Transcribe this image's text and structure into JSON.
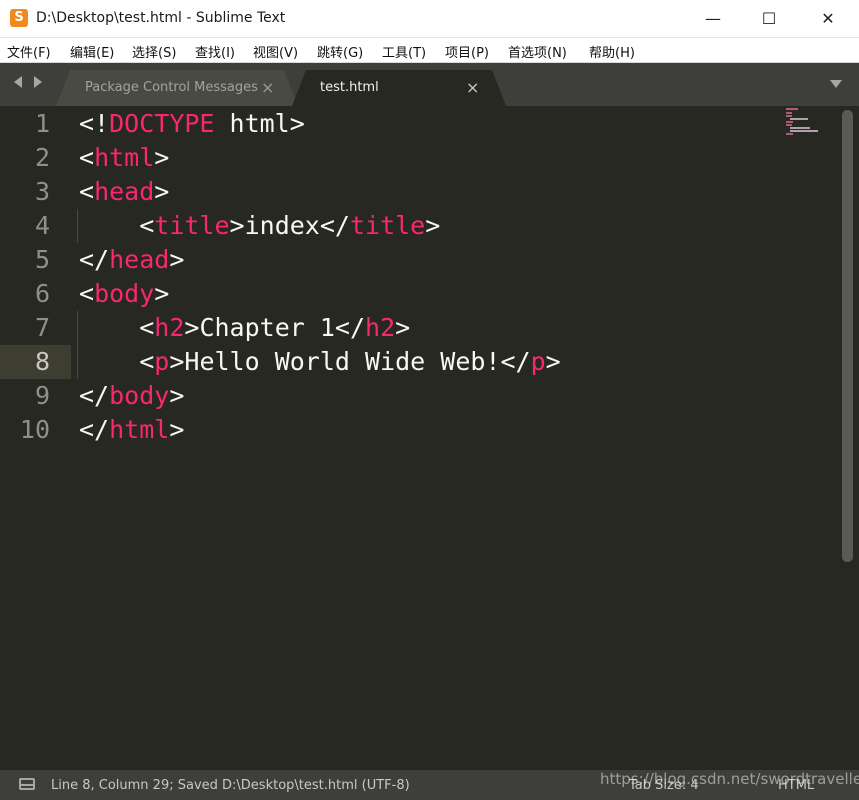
{
  "window": {
    "title": "D:\\Desktop\\test.html - Sublime Text",
    "app_icon": "S",
    "controls": {
      "minimize": "—",
      "maximize": "☐",
      "close": "✕"
    }
  },
  "menu": [
    "文件(F)",
    "编辑(E)",
    "选择(S)",
    "查找(I)",
    "视图(V)",
    "跳转(G)",
    "工具(T)",
    "项目(P)",
    "首选项(N)",
    "帮助(H)"
  ],
  "tabs": [
    {
      "label": "Package Control Messages",
      "active": false,
      "close": "×"
    },
    {
      "label": "test.html",
      "active": true,
      "close": "×"
    }
  ],
  "editor": {
    "current_line": 8,
    "lines": [
      {
        "num": "1",
        "indent": "",
        "parts": [
          [
            "p",
            "<!"
          ],
          [
            "t",
            "DOCTYPE"
          ],
          [
            "p",
            " html>"
          ]
        ]
      },
      {
        "num": "2",
        "indent": "",
        "parts": [
          [
            "p",
            "<"
          ],
          [
            "t",
            "html"
          ],
          [
            "p",
            ">"
          ]
        ]
      },
      {
        "num": "3",
        "indent": "",
        "parts": [
          [
            "p",
            "<"
          ],
          [
            "t",
            "head"
          ],
          [
            "p",
            ">"
          ]
        ]
      },
      {
        "num": "4",
        "indent": "    ",
        "parts": [
          [
            "p",
            "<"
          ],
          [
            "t",
            "title"
          ],
          [
            "p",
            ">index</"
          ],
          [
            "t",
            "title"
          ],
          [
            "p",
            ">"
          ]
        ]
      },
      {
        "num": "5",
        "indent": "",
        "parts": [
          [
            "p",
            "</"
          ],
          [
            "t",
            "head"
          ],
          [
            "p",
            ">"
          ]
        ]
      },
      {
        "num": "6",
        "indent": "",
        "parts": [
          [
            "p",
            "<"
          ],
          [
            "t",
            "body"
          ],
          [
            "p",
            ">"
          ]
        ]
      },
      {
        "num": "7",
        "indent": "    ",
        "parts": [
          [
            "p",
            "<"
          ],
          [
            "t",
            "h2"
          ],
          [
            "p",
            ">Chapter 1</"
          ],
          [
            "t",
            "h2"
          ],
          [
            "p",
            ">"
          ]
        ]
      },
      {
        "num": "8",
        "indent": "    ",
        "parts": [
          [
            "p",
            "<"
          ],
          [
            "t",
            "p"
          ],
          [
            "p",
            ">Hello World Wide Web!</"
          ],
          [
            "t",
            "p"
          ],
          [
            "p",
            ">"
          ]
        ]
      },
      {
        "num": "9",
        "indent": "",
        "parts": [
          [
            "p",
            "</"
          ],
          [
            "t",
            "body"
          ],
          [
            "p",
            ">"
          ]
        ]
      },
      {
        "num": "10",
        "indent": "",
        "parts": [
          [
            "p",
            "</"
          ],
          [
            "t",
            "html"
          ],
          [
            "p",
            ">"
          ]
        ]
      }
    ]
  },
  "status": {
    "panel_icon": "panel-toggle-icon",
    "position": "Line 8, Column 29; Saved D:\\Desktop\\test.html (UTF-8)",
    "tab_size": "Tab Size: 4",
    "syntax": "HTML"
  },
  "watermark": "https://blog.csdn.net/swordtraveller",
  "colors": {
    "background": "#272822",
    "tag": "#f92672",
    "text": "#f8f8f2",
    "gutter": "#8f908a",
    "current_line": "#3e3d32"
  }
}
